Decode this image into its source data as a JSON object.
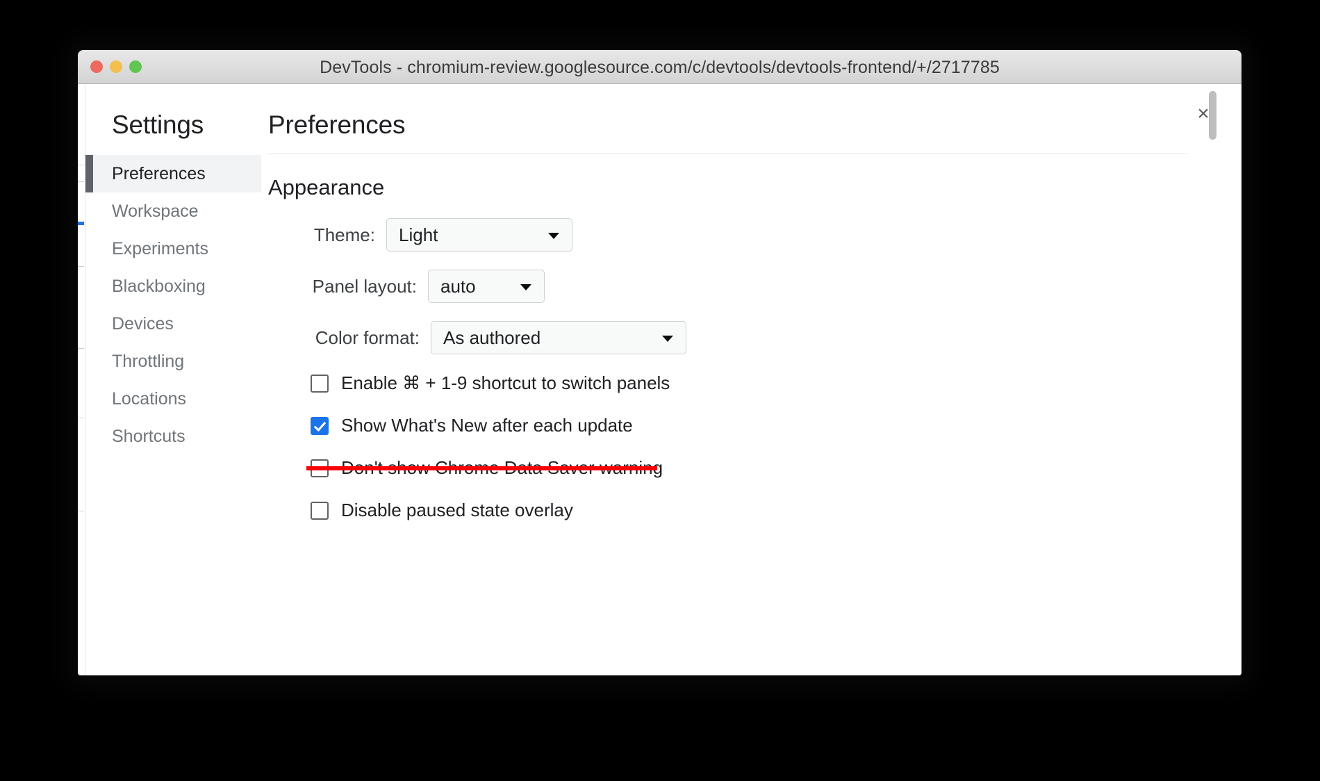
{
  "window": {
    "title": "DevTools - chromium-review.googlesource.com/c/devtools/devtools-frontend/+/2717785",
    "traffic_lights": {
      "close_color": "#ec6a5f",
      "minimize_color": "#f3bf4f",
      "zoom_color": "#61c554"
    }
  },
  "dialog": {
    "close_label": "×",
    "sidebar": {
      "title": "Settings",
      "items": [
        {
          "label": "Preferences",
          "selected": true
        },
        {
          "label": "Workspace",
          "selected": false
        },
        {
          "label": "Experiments",
          "selected": false
        },
        {
          "label": "Blackboxing",
          "selected": false
        },
        {
          "label": "Devices",
          "selected": false
        },
        {
          "label": "Throttling",
          "selected": false
        },
        {
          "label": "Locations",
          "selected": false
        },
        {
          "label": "Shortcuts",
          "selected": false
        }
      ]
    },
    "main": {
      "title": "Preferences",
      "sections": [
        {
          "heading": "Appearance",
          "selects": [
            {
              "label": "Theme:",
              "value": "Light",
              "icon": "chevron-down-icon"
            },
            {
              "label": "Panel layout:",
              "value": "auto",
              "icon": "chevron-down-icon"
            },
            {
              "label": "Color format:",
              "value": "As authored",
              "icon": "chevron-down-icon"
            }
          ],
          "checkboxes": [
            {
              "label": "Enable ⌘ + 1-9 shortcut to switch panels",
              "checked": false,
              "struck": false
            },
            {
              "label": "Show What's New after each update",
              "checked": true,
              "struck": false
            },
            {
              "label": "Don't show Chrome Data Saver warning",
              "checked": false,
              "struck": true
            },
            {
              "label": "Disable paused state overlay",
              "checked": false,
              "struck": false
            }
          ]
        }
      ]
    }
  },
  "colors": {
    "accent": "#1a73e8",
    "annotation_red": "#fb0007",
    "selected_row_bg": "#f1f3f4",
    "selected_row_marker": "#5f6368",
    "text_primary": "#202124",
    "text_secondary": "#70757a"
  }
}
